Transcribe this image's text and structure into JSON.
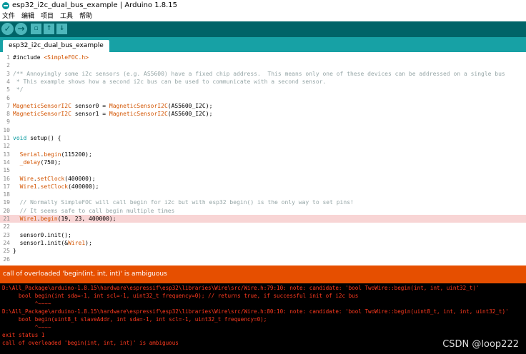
{
  "window": {
    "title": "esp32_i2c_dual_bus_example | Arduino 1.8.15"
  },
  "menu": [
    "文件",
    "编辑",
    "项目",
    "工具",
    "帮助"
  ],
  "toolbar": {
    "verify": "✓",
    "upload": "→",
    "new": "▫",
    "open": "↑",
    "save": "↓"
  },
  "tab": {
    "label": "esp32_i2c_dual_bus_example"
  },
  "code": [
    {
      "n": "1",
      "t": "#include <SimpleFOC.h>"
    },
    {
      "n": "2",
      "t": ""
    },
    {
      "n": "3",
      "t": "/** Annoyingly some i2c sensors (e.g. AS5600) have a fixed chip address.  This means only one of these devices can be addressed on a single bus"
    },
    {
      "n": "4",
      "t": " * This example shows how a second i2c bus can be used to communicate with a second sensor."
    },
    {
      "n": "5",
      "t": " */"
    },
    {
      "n": "6",
      "t": ""
    },
    {
      "n": "7",
      "t": "MagneticSensorI2C sensor0 = MagneticSensorI2C(AS5600_I2C);"
    },
    {
      "n": "8",
      "t": "MagneticSensorI2C sensor1 = MagneticSensorI2C(AS5600_I2C);"
    },
    {
      "n": "9",
      "t": ""
    },
    {
      "n": "10",
      "t": ""
    },
    {
      "n": "11",
      "t": "void setup() {"
    },
    {
      "n": "12",
      "t": ""
    },
    {
      "n": "13",
      "t": "  Serial.begin(115200);"
    },
    {
      "n": "14",
      "t": "  _delay(750);"
    },
    {
      "n": "15",
      "t": ""
    },
    {
      "n": "16",
      "t": "  Wire.setClock(400000);"
    },
    {
      "n": "17",
      "t": "  Wire1.setClock(400000);"
    },
    {
      "n": "18",
      "t": ""
    },
    {
      "n": "19",
      "t": "  // Normally SimpleFOC will call begin for i2c but with esp32 begin() is the only way to set pins!"
    },
    {
      "n": "20",
      "t": "  // It seems safe to call begin multiple times"
    },
    {
      "n": "21",
      "t": "  Wire1.begin(19, 23, 400000);"
    },
    {
      "n": "22",
      "t": ""
    },
    {
      "n": "23",
      "t": "  sensor0.init();"
    },
    {
      "n": "24",
      "t": "  sensor1.init(&Wire1);"
    },
    {
      "n": "25",
      "t": "}"
    },
    {
      "n": "26",
      "t": ""
    }
  ],
  "error_bar": "call of overloaded 'begin(int, int, int)' is ambiguous",
  "console": [
    "D:\\All_Package\\arduino-1.8.15\\hardware\\espressif\\esp32\\libraries\\Wire\\src/Wire.h:79:10: note: candidate: 'bool TwoWire::begin(int, int, uint32_t)'",
    "     bool begin(int sda=-1, int scl=-1, uint32_t frequency=0); // returns true, if successful init of i2c bus",
    "          ^~~~~",
    "D:\\All_Package\\arduino-1.8.15\\hardware\\espressif\\esp32\\libraries\\Wire\\src/Wire.h:80:10: note: candidate: 'bool TwoWire::begin(uint8_t, int, int, uint32_t)'",
    "     bool begin(uint8_t slaveAddr, int sda=-1, int scl=-1, uint32_t frequency=0);",
    "          ^~~~~",
    "exit status 1",
    "call of overloaded 'begin(int, int, int)' is ambiguous"
  ],
  "watermark": "CSDN @loop222",
  "colors": {
    "toolbar": "#006468",
    "tabstrip": "#17a1a5",
    "error": "#e64f00",
    "console_text": "#ff3a1f",
    "highlight": "#f8d5d5"
  }
}
